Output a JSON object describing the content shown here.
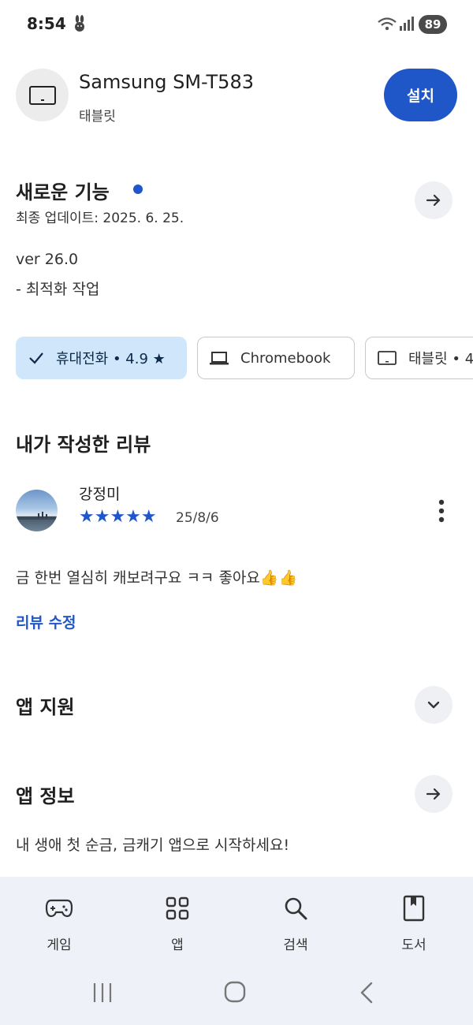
{
  "status_bar": {
    "time": "8:54",
    "battery": "89"
  },
  "app_header": {
    "device_name": "Samsung SM-T583",
    "device_type": "태블릿",
    "install_label": "설치"
  },
  "whats_new": {
    "title": "새로운 기능",
    "updated": "최종 업데이트: 2025. 6. 25.",
    "version": "ver 26.0",
    "notes": "- 최적화 작업"
  },
  "device_chips": [
    {
      "label": "휴대전화 • 4.9 ★",
      "selected": true
    },
    {
      "label": "Chromebook",
      "selected": false
    },
    {
      "label": "태블릿 • 4",
      "selected": false
    }
  ],
  "my_review": {
    "section_title": "내가 작성한 리뷰",
    "reviewer": "강정미",
    "stars": "★★★★★",
    "rating": 5,
    "date": "25/8/6",
    "text": "금 한번 열심히 캐보려구요 ㅋㅋ 좋아요👍👍",
    "edit_label": "리뷰 수정"
  },
  "app_support": {
    "title": "앱 지원"
  },
  "app_info": {
    "title": "앱 정보",
    "description": "내 생애 첫 순금, 금캐기 앱으로 시작하세요!"
  },
  "bottom_nav": [
    {
      "label": "게임",
      "icon": "gamepad-icon"
    },
    {
      "label": "앱",
      "icon": "apps-grid-icon"
    },
    {
      "label": "검색",
      "icon": "search-icon"
    },
    {
      "label": "도서",
      "icon": "book-icon"
    }
  ],
  "colors": {
    "accent": "#1f57c8",
    "chip_selected_bg": "#cfe6fb",
    "nav_bg": "#eef1f7"
  }
}
